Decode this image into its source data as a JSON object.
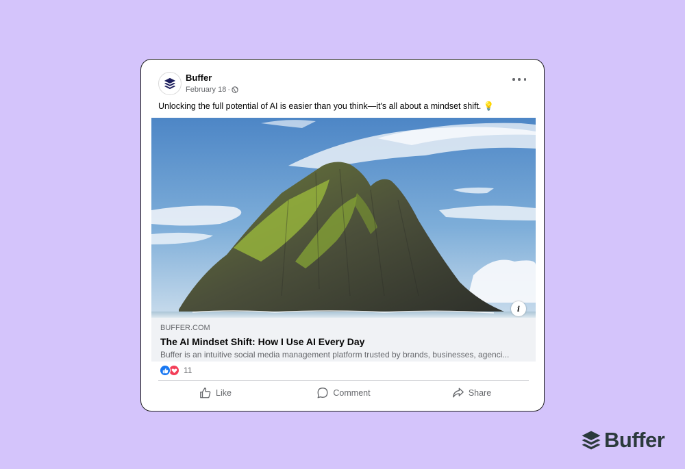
{
  "post": {
    "page_name": "Buffer",
    "date": "February 18",
    "separator": "·",
    "text": "Unlocking the full potential of AI is easier than you think—it's all about a mindset shift. 💡",
    "privacy_icon": "globe-icon",
    "more_icon": "more-options-icon"
  },
  "link_preview": {
    "domain": "BUFFER.COM",
    "title": "The AI Mindset Shift: How I Use AI Every Day",
    "description": "Buffer is an intuitive social media management platform trusted by brands, businesses, agenci...",
    "image_alt": "Rocky green island under a blue sky",
    "info_icon": "i"
  },
  "reactions": {
    "count": "11",
    "types": [
      "like",
      "love"
    ]
  },
  "actions": {
    "like": "Like",
    "comment": "Comment",
    "share": "Share"
  },
  "brand": {
    "name": "Buffer"
  },
  "colors": {
    "background": "#d4c4fb",
    "facebook_blue": "#1877f2",
    "love_red": "#f33e58",
    "brand_dark": "#2b3a3c",
    "avatar_navy": "#1d1f5e"
  }
}
